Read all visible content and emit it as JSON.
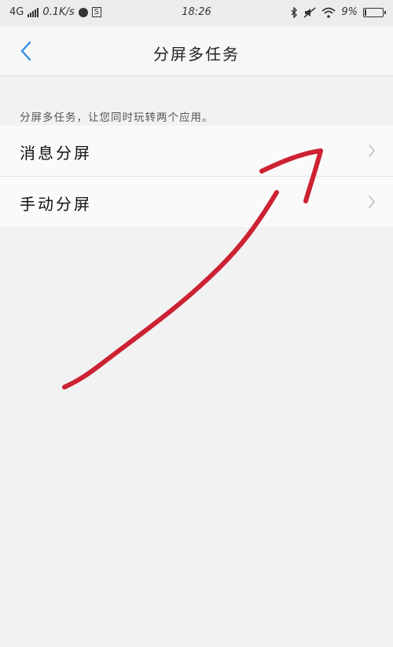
{
  "status_bar": {
    "network": "4G",
    "speed": "0.1K/s",
    "s_badge": "S",
    "time": "18:26",
    "battery": "9%",
    "battery_level": 0.09,
    "icons": [
      "signal-icon",
      "browser-icon",
      "bluetooth-icon",
      "mute-icon",
      "wifi-icon",
      "battery-icon"
    ]
  },
  "header": {
    "back_icon": "chevron-left-icon",
    "title": "分屏多任务"
  },
  "description": "分屏多任务，让您同时玩转两个应用。",
  "items": [
    {
      "label": "消息分屏",
      "icon": "chevron-right-icon"
    },
    {
      "label": "手动分屏",
      "icon": "chevron-right-icon"
    }
  ],
  "colors": {
    "accent": "#2f8de4",
    "annotation": "#cc2233",
    "background": "#f2f2f2"
  }
}
